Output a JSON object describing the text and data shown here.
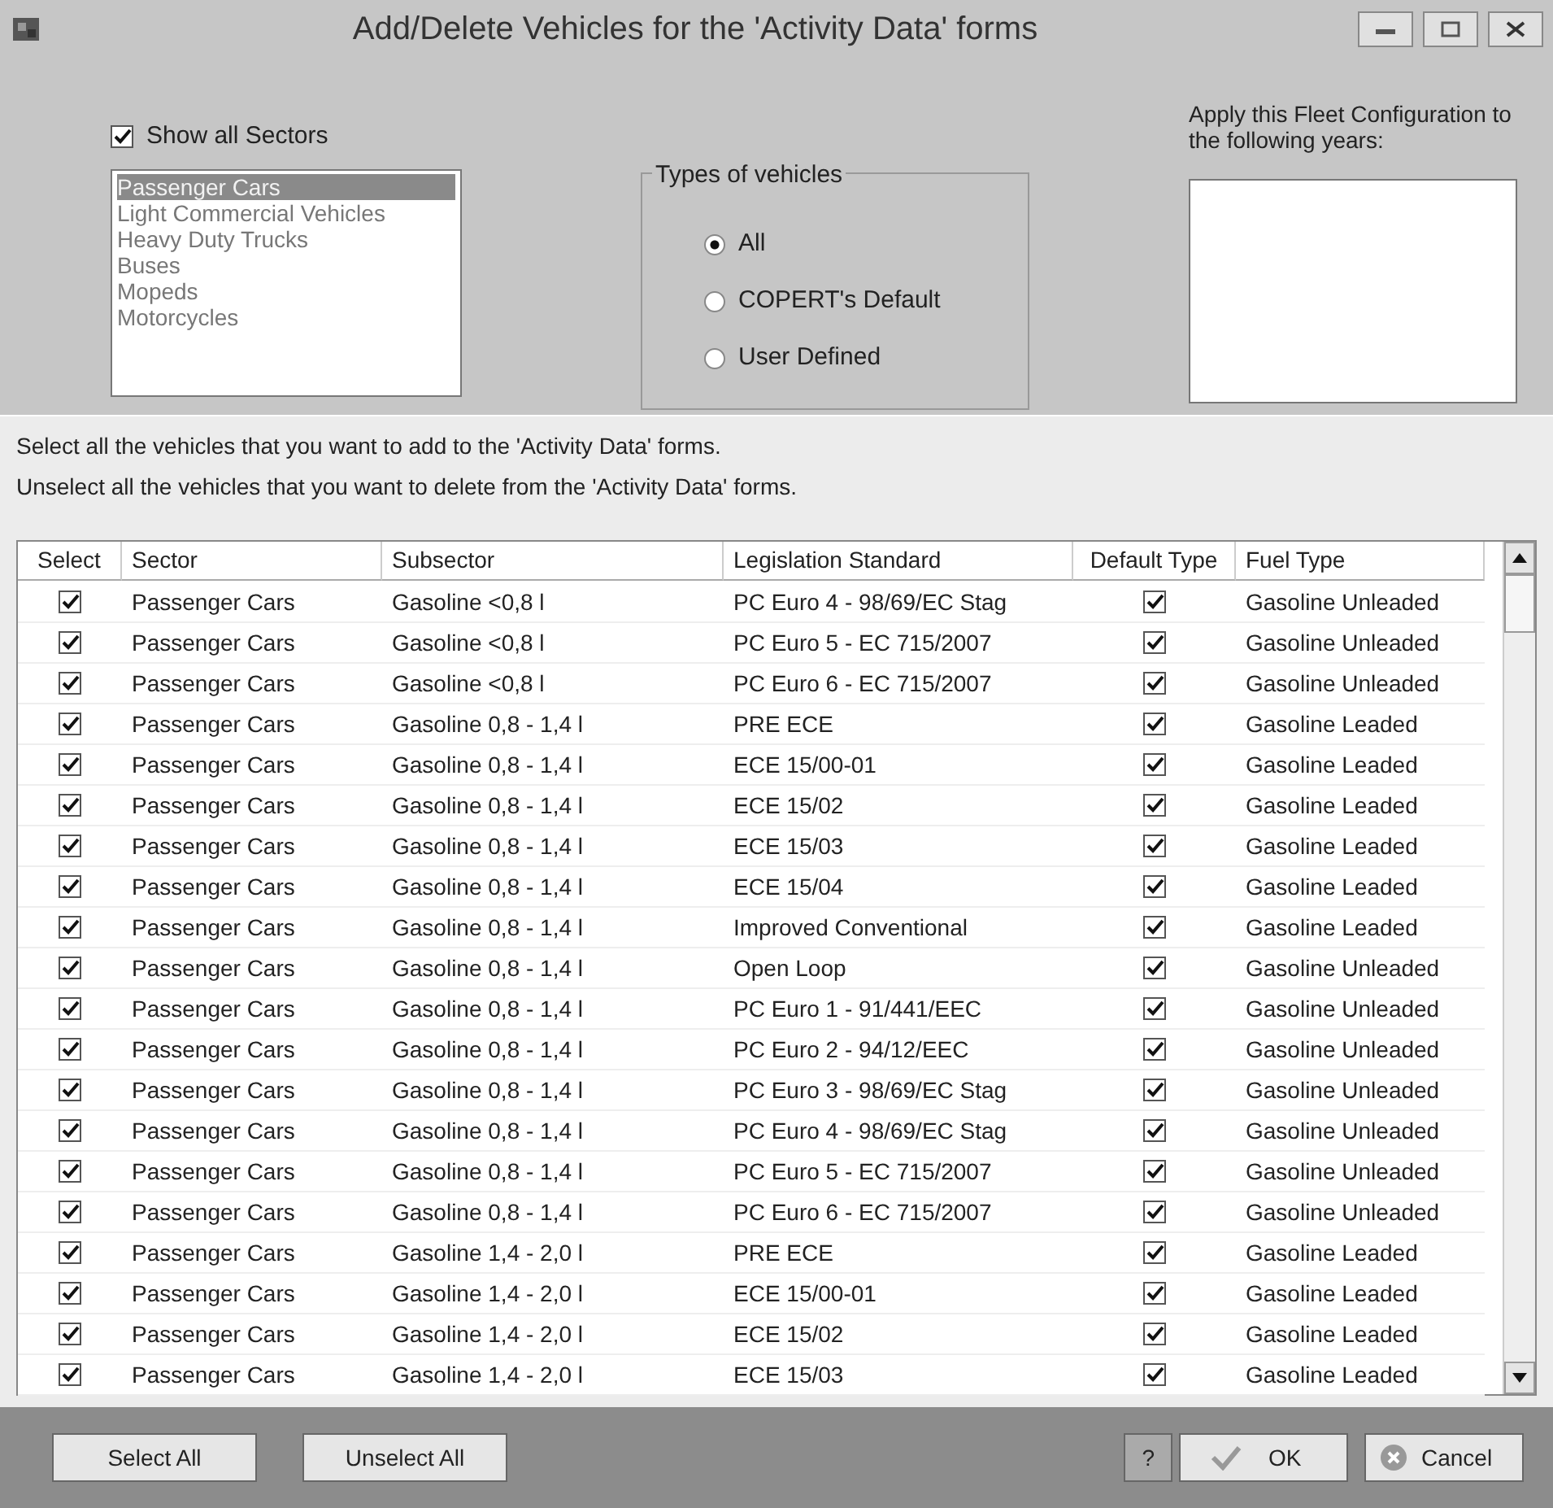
{
  "window": {
    "title": "Add/Delete Vehicles for the 'Activity Data' forms"
  },
  "show_all_sectors": {
    "label": "Show all Sectors",
    "checked": true
  },
  "sectors": [
    {
      "label": "Passenger Cars",
      "selected": true
    },
    {
      "label": "Light Commercial Vehicles",
      "selected": false
    },
    {
      "label": "Heavy Duty Trucks",
      "selected": false
    },
    {
      "label": "Buses",
      "selected": false
    },
    {
      "label": "Mopeds",
      "selected": false
    },
    {
      "label": "Motorcycles",
      "selected": false
    }
  ],
  "types_of_vehicles": {
    "title": "Types of vehicles",
    "options": [
      {
        "label": "All",
        "selected": true
      },
      {
        "label": "COPERT's Default",
        "selected": false
      },
      {
        "label": "User Defined",
        "selected": false
      }
    ]
  },
  "years": {
    "label": "Apply this Fleet Configuration to the following years:"
  },
  "vehicles_group": {
    "title": "Select all the vehicles that you want to add to the 'Activity Data' forms.",
    "note": "Unselect all the vehicles that you want to delete from the 'Activity Data' forms."
  },
  "table": {
    "columns": [
      "Select",
      "Sector",
      "Subsector",
      "Legislation Standard",
      "Default Type",
      "Fuel Type"
    ],
    "rows": [
      {
        "select": true,
        "sector": "Passenger Cars",
        "subsector": "Gasoline <0,8 l",
        "legislation": "PC Euro 4 - 98/69/EC Stag",
        "default_type": true,
        "fuel": "Gasoline Unleaded"
      },
      {
        "select": true,
        "sector": "Passenger Cars",
        "subsector": "Gasoline <0,8 l",
        "legislation": "PC Euro 5 - EC 715/2007",
        "default_type": true,
        "fuel": "Gasoline Unleaded"
      },
      {
        "select": true,
        "sector": "Passenger Cars",
        "subsector": "Gasoline <0,8 l",
        "legislation": "PC Euro 6 - EC 715/2007",
        "default_type": true,
        "fuel": "Gasoline Unleaded"
      },
      {
        "select": true,
        "sector": "Passenger Cars",
        "subsector": "Gasoline 0,8 - 1,4 l",
        "legislation": "PRE ECE",
        "default_type": true,
        "fuel": "Gasoline Leaded"
      },
      {
        "select": true,
        "sector": "Passenger Cars",
        "subsector": "Gasoline 0,8 - 1,4 l",
        "legislation": "ECE 15/00-01",
        "default_type": true,
        "fuel": "Gasoline Leaded"
      },
      {
        "select": true,
        "sector": "Passenger Cars",
        "subsector": "Gasoline 0,8 - 1,4 l",
        "legislation": "ECE 15/02",
        "default_type": true,
        "fuel": "Gasoline Leaded"
      },
      {
        "select": true,
        "sector": "Passenger Cars",
        "subsector": "Gasoline 0,8 - 1,4 l",
        "legislation": "ECE 15/03",
        "default_type": true,
        "fuel": "Gasoline Leaded"
      },
      {
        "select": true,
        "sector": "Passenger Cars",
        "subsector": "Gasoline 0,8 - 1,4 l",
        "legislation": "ECE 15/04",
        "default_type": true,
        "fuel": "Gasoline Leaded"
      },
      {
        "select": true,
        "sector": "Passenger Cars",
        "subsector": "Gasoline 0,8 - 1,4 l",
        "legislation": "Improved Conventional",
        "default_type": true,
        "fuel": "Gasoline Leaded"
      },
      {
        "select": true,
        "sector": "Passenger Cars",
        "subsector": "Gasoline 0,8 - 1,4 l",
        "legislation": "Open Loop",
        "default_type": true,
        "fuel": "Gasoline Unleaded"
      },
      {
        "select": true,
        "sector": "Passenger Cars",
        "subsector": "Gasoline 0,8 - 1,4 l",
        "legislation": "PC Euro 1 - 91/441/EEC",
        "default_type": true,
        "fuel": "Gasoline Unleaded"
      },
      {
        "select": true,
        "sector": "Passenger Cars",
        "subsector": "Gasoline 0,8 - 1,4 l",
        "legislation": "PC Euro 2 - 94/12/EEC",
        "default_type": true,
        "fuel": "Gasoline Unleaded"
      },
      {
        "select": true,
        "sector": "Passenger Cars",
        "subsector": "Gasoline 0,8 - 1,4 l",
        "legislation": "PC Euro 3 - 98/69/EC Stag",
        "default_type": true,
        "fuel": "Gasoline Unleaded"
      },
      {
        "select": true,
        "sector": "Passenger Cars",
        "subsector": "Gasoline 0,8 - 1,4 l",
        "legislation": "PC Euro 4 - 98/69/EC Stag",
        "default_type": true,
        "fuel": "Gasoline Unleaded"
      },
      {
        "select": true,
        "sector": "Passenger Cars",
        "subsector": "Gasoline 0,8 - 1,4 l",
        "legislation": "PC Euro 5 - EC 715/2007",
        "default_type": true,
        "fuel": "Gasoline Unleaded"
      },
      {
        "select": true,
        "sector": "Passenger Cars",
        "subsector": "Gasoline 0,8 - 1,4 l",
        "legislation": "PC Euro 6 - EC 715/2007",
        "default_type": true,
        "fuel": "Gasoline Unleaded"
      },
      {
        "select": true,
        "sector": "Passenger Cars",
        "subsector": "Gasoline 1,4 - 2,0 l",
        "legislation": "PRE ECE",
        "default_type": true,
        "fuel": "Gasoline Leaded"
      },
      {
        "select": true,
        "sector": "Passenger Cars",
        "subsector": "Gasoline 1,4 - 2,0 l",
        "legislation": "ECE 15/00-01",
        "default_type": true,
        "fuel": "Gasoline Leaded"
      },
      {
        "select": true,
        "sector": "Passenger Cars",
        "subsector": "Gasoline 1,4 - 2,0 l",
        "legislation": "ECE 15/02",
        "default_type": true,
        "fuel": "Gasoline Leaded"
      },
      {
        "select": true,
        "sector": "Passenger Cars",
        "subsector": "Gasoline 1,4 - 2,0 l",
        "legislation": "ECE 15/03",
        "default_type": true,
        "fuel": "Gasoline Leaded"
      }
    ]
  },
  "buttons": {
    "select_all": "Select All",
    "unselect_all": "Unselect All",
    "help": "?",
    "ok": "OK",
    "cancel": "Cancel"
  }
}
